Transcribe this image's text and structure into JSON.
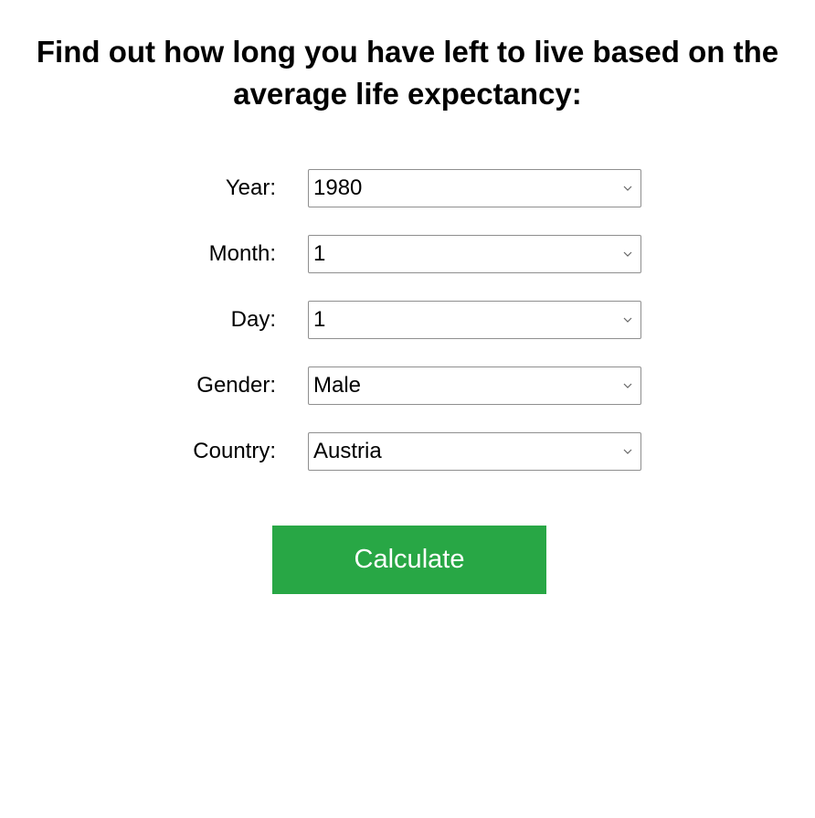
{
  "header": {
    "title": "Find out how long you have left to live based on the average life expectancy:"
  },
  "form": {
    "fields": [
      {
        "label": "Year:",
        "value": "1980",
        "icon": "chevron-down-icon"
      },
      {
        "label": "Month:",
        "value": "1",
        "icon": "chevron-down-icon"
      },
      {
        "label": "Day:",
        "value": "1",
        "icon": "chevron-down-icon"
      },
      {
        "label": "Gender:",
        "value": "Male",
        "icon": "chevron-down-icon"
      },
      {
        "label": "Country:",
        "value": "Austria",
        "icon": "chevron-down-icon"
      }
    ],
    "submit_label": "Calculate"
  },
  "colors": {
    "button_bg": "#28a745",
    "button_text": "#ffffff",
    "select_border": "#8f8f8f",
    "text": "#000000"
  }
}
